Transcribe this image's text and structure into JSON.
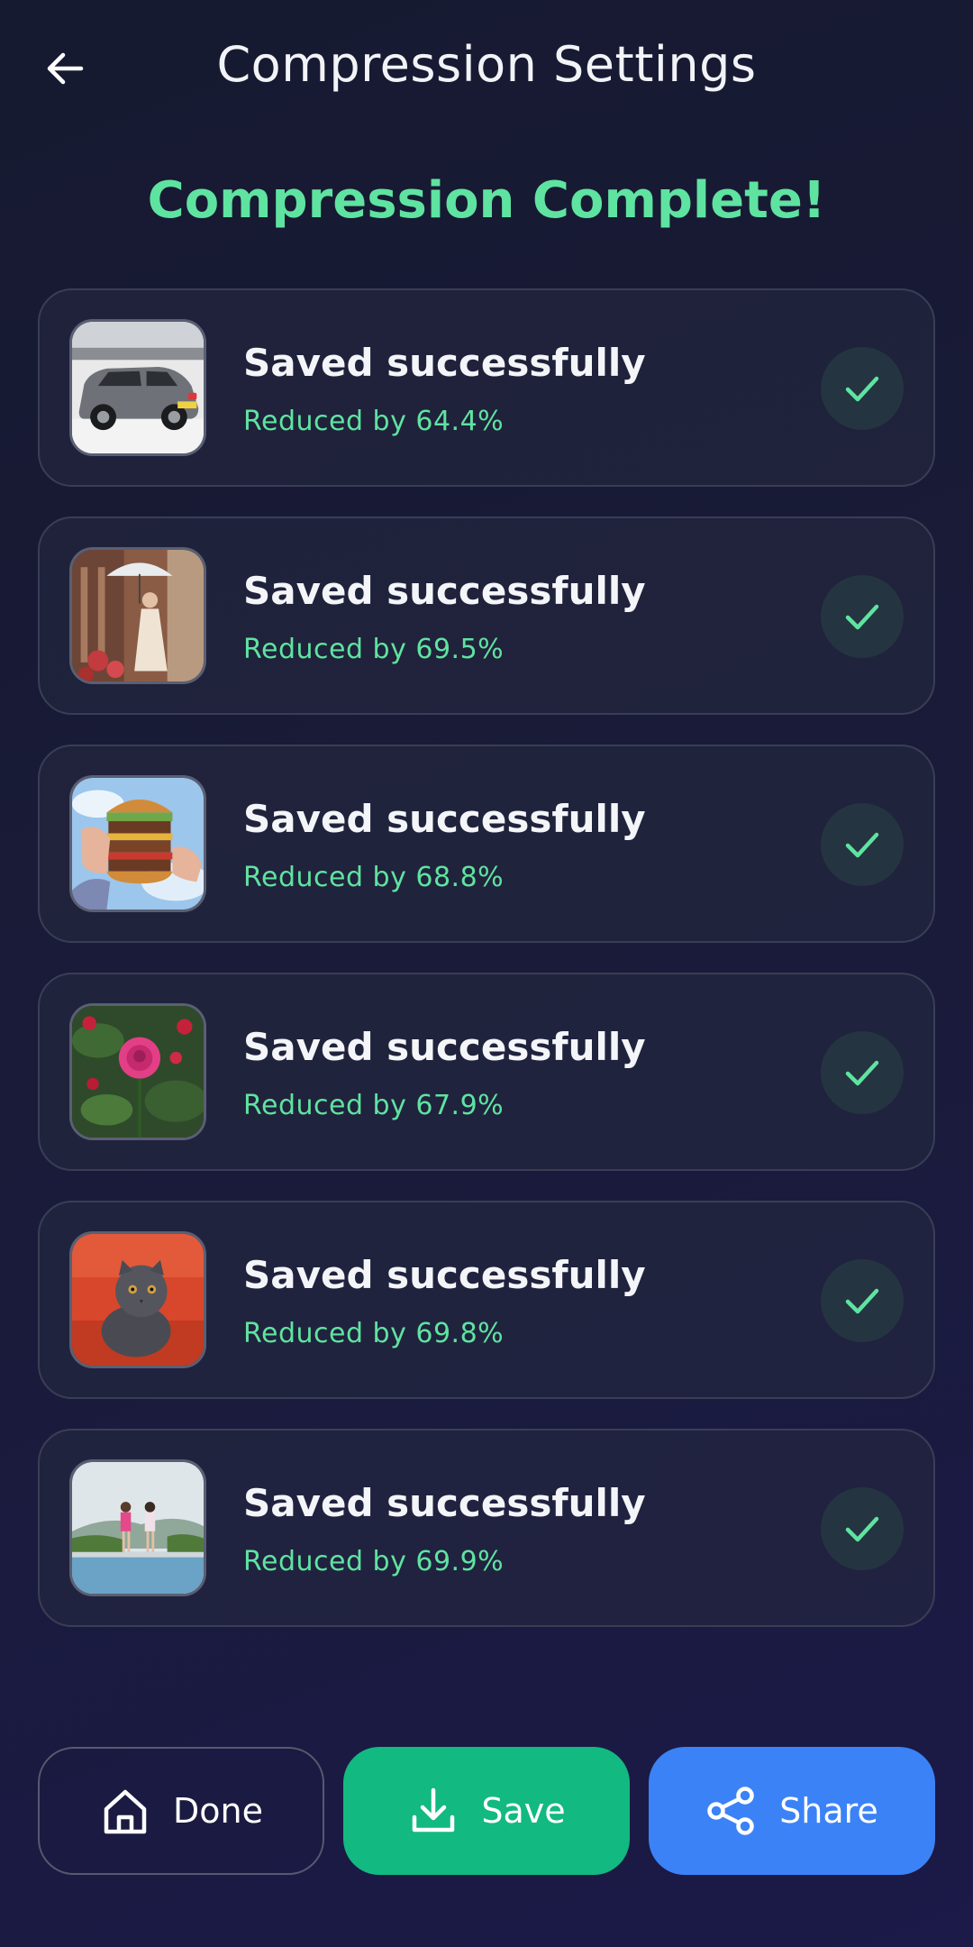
{
  "header": {
    "title": "Compression Settings",
    "back_icon": "arrow-left-icon"
  },
  "status": {
    "heading": "Compression Complete!",
    "accent_color": "#5fe3a1"
  },
  "results": [
    {
      "title": "Saved successfully",
      "detail": "Reduced by 64.4%",
      "thumbnail": "car"
    },
    {
      "title": "Saved successfully",
      "detail": "Reduced by 69.5%",
      "thumbnail": "woman-with-umbrella"
    },
    {
      "title": "Saved successfully",
      "detail": "Reduced by 68.8%",
      "thumbnail": "burger"
    },
    {
      "title": "Saved successfully",
      "detail": "Reduced by 67.9%",
      "thumbnail": "pink-rose"
    },
    {
      "title": "Saved successfully",
      "detail": "Reduced by 69.8%",
      "thumbnail": "cat-on-red-sofa"
    },
    {
      "title": "Saved successfully",
      "detail": "Reduced by 69.9%",
      "thumbnail": "two-women-at-pool"
    }
  ],
  "actions": {
    "done": {
      "label": "Done",
      "icon": "home-icon",
      "color": "transparent"
    },
    "save": {
      "label": "Save",
      "icon": "download-icon",
      "color": "#12b981"
    },
    "share": {
      "label": "Share",
      "icon": "share-icon",
      "color": "#3b82f6"
    }
  },
  "colors": {
    "background": "#1a1b3a",
    "card_border": "#3a3e55",
    "check_icon": "#5fe3a1"
  }
}
